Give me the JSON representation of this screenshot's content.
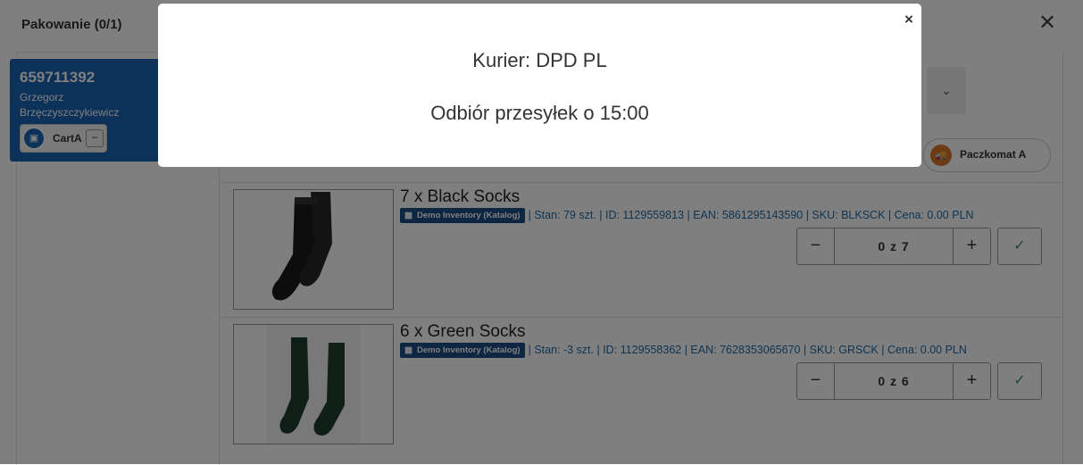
{
  "header": {
    "title": "Pakowanie  (0/1)",
    "close": "✕"
  },
  "order": {
    "id": "659711392",
    "customer": "Grzegorz Brzęczyszczykiewicz",
    "cart_label": "CartA",
    "cart_minus": "−"
  },
  "shipping": {
    "dropdown_chevron": "⌄",
    "paczkomat_label": "Paczkomat A",
    "truck_glyph": "🚚"
  },
  "products": [
    {
      "name": "7 x Black Socks",
      "inventory": "Demo Inventory (Katalog)",
      "details": "| Stan: 79 szt. | ID: 1129559813 | EAN: 5861295143590 | SKU: BLKSCK | Cena: 0.00 PLN",
      "qty": "0 z 7",
      "minus": "−",
      "plus": "+",
      "check": "✓"
    },
    {
      "name": "6 x Green Socks",
      "inventory": "Demo Inventory (Katalog)",
      "details": "| Stan: -3 szt. | ID: 1129558362 | EAN: 7628353065670 | SKU: GRSCK | Cena: 0.00 PLN",
      "qty": "0 z 6",
      "minus": "−",
      "plus": "+",
      "check": "✓"
    }
  ],
  "modal": {
    "line1": "Kurier: DPD PL",
    "line2": "Odbiór przesyłek o 15:00",
    "close": "×"
  },
  "colors": {
    "accent": "#1b64b4",
    "tag": "#1b4f85",
    "link": "#1f6aa5"
  }
}
